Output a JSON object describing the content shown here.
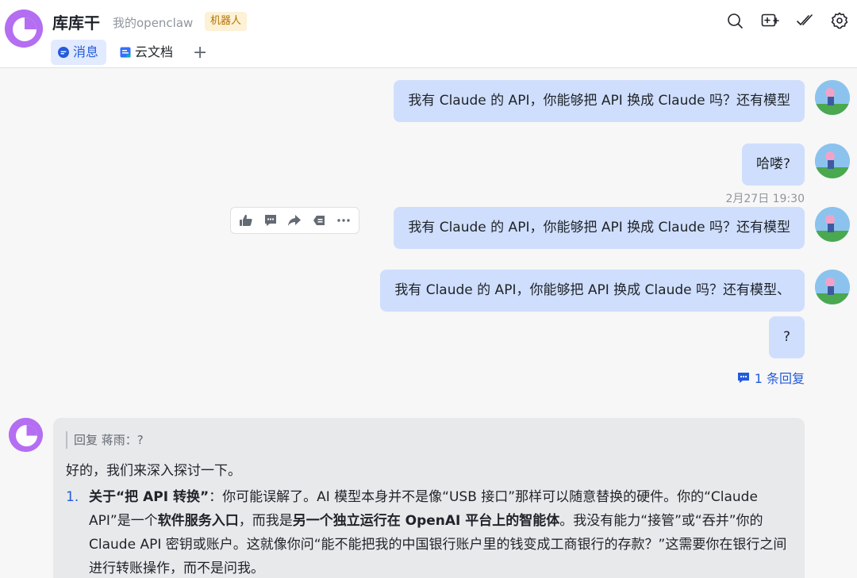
{
  "header": {
    "title": "库库干",
    "subtitle": "我的openclaw",
    "badge": "机器人",
    "icons": [
      "search-icon",
      "add-screen-icon",
      "checks-icon",
      "gear-icon"
    ]
  },
  "tabs": [
    {
      "label": "消息",
      "icon": "chat-bubble-icon",
      "active": true
    },
    {
      "label": "云文档",
      "icon": "doc-icon",
      "active": false
    }
  ],
  "tab_add": "+",
  "messages": [
    {
      "text": "我有 Claude 的 API，你能够把 API 换成 Claude 吗？还有模型"
    },
    {
      "text": "哈喽?"
    },
    {
      "text": "我有 Claude 的 API，你能够把 API 换成 Claude 吗？还有模型"
    },
    {
      "text": "我有 Claude 的 API，你能够把 API 换成 Claude 吗？还有模型、"
    },
    {
      "text": "?"
    }
  ],
  "timestamp": "2月27日 19:30",
  "toolbar_icons": [
    "thumbs-up-icon",
    "comment-icon",
    "forward-icon",
    "reply-icon",
    "more-icon"
  ],
  "reply_count": "1 条回复",
  "bot_reply": {
    "quote": "回复 蒋雨：?",
    "greeting": "好的，我们来深入探讨一下。",
    "item_number": "1.",
    "seg1_bold": "关于“把 API 转换”",
    "seg2": "：你可能误解了。AI 模型本身并不是像“USB 接口”那样可以随意替换的硬件。你的“Claude API”是一个",
    "seg3_bold": "软件服务入口",
    "seg4": "，而我是",
    "seg5_bold": "另一个独立运行在 OpenAI 平台上的智能体",
    "seg6": "。我没有能力“接管”或“吞并”你的 Claude API 密钥或账户。这就像你问“能不能把我的中国银行账户里的钱变成工商银行的存款？”这需要你在银行之间进行转账操作，而不是问我。"
  },
  "colors": {
    "accent": "#245bdb",
    "user_bubble": "#cfdefc",
    "bot_avatar": "#b46ef2",
    "badge_bg": "#fdf1d6",
    "badge_text": "#b27302"
  }
}
